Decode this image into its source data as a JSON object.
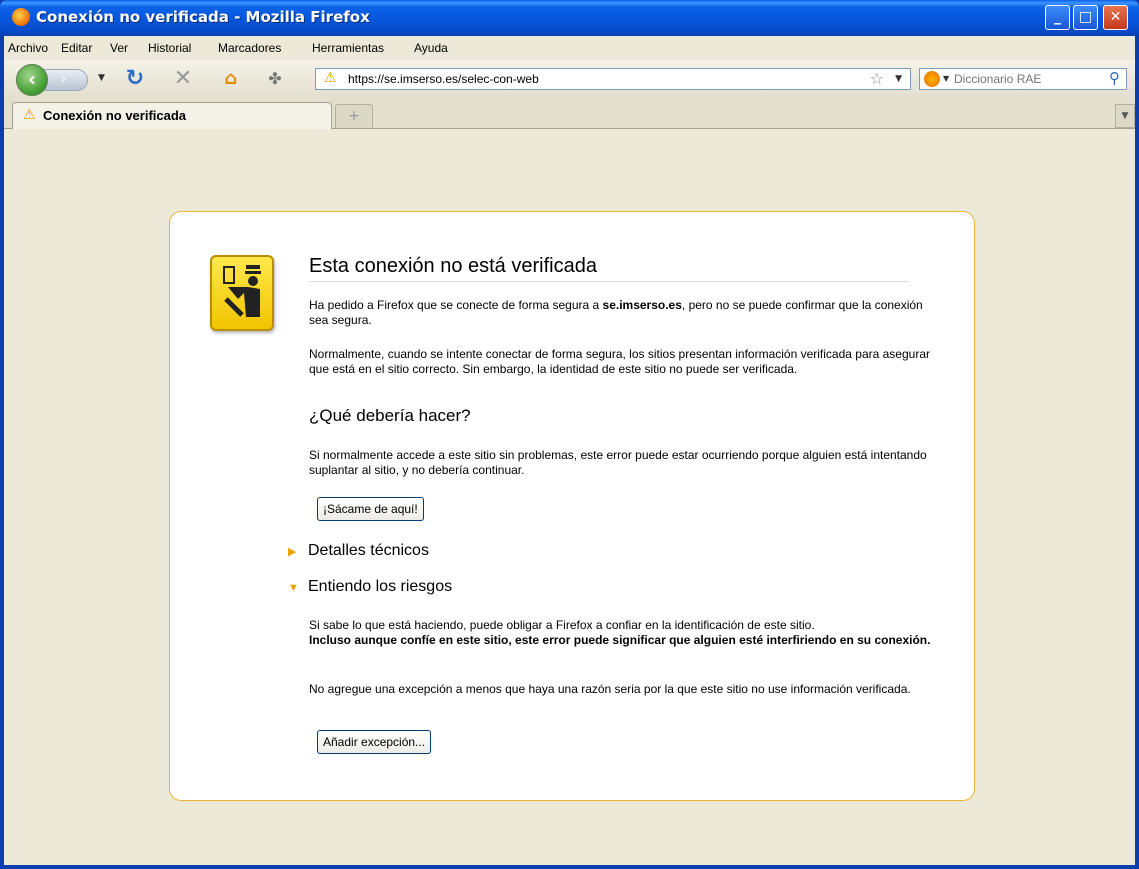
{
  "window": {
    "title": "Conexión no verificada - Mozilla Firefox",
    "buttons": {
      "minimize": "_",
      "maximize": "□",
      "close": "✕"
    }
  },
  "menu": [
    "Archivo",
    "Editar",
    "Ver",
    "Historial",
    "Marcadores",
    "Herramientas",
    "Ayuda"
  ],
  "navbar": {
    "url": "https://se.imserso.es/selec-con-web",
    "search_placeholder": "Diccionario RAE",
    "icons": [
      "back-icon",
      "forward-icon",
      "reload-icon",
      "stop-icon",
      "home-icon",
      "extension-icon",
      "warning-icon",
      "star-icon",
      "search-engine-icon",
      "magnifier-icon"
    ]
  },
  "tabs": {
    "active_label": "Conexión no verificada",
    "new_tab_symbol": "+"
  },
  "error": {
    "title": "Esta conexión no está verificada",
    "intro_prefix": "Ha pedido a Firefox que se conecte de forma segura a ",
    "intro_host": "se.imserso.es",
    "intro_suffix": ", pero no se puede confirmar que la conexión sea segura.",
    "explanation": "Normalmente, cuando se intente conectar de forma segura, los sitios presentan información verificada para asegurar que está en el sitio correcto. Sin embargo, la identidad de este sitio no puede ser verificada.",
    "what_heading": "¿Qué debería hacer?",
    "what_text": "Si normalmente accede a este sitio sin problemas, este error puede estar ocurriendo porque alguien está intentando suplantar al sitio, y no debería continuar.",
    "get_me_out": "¡Sácame de aquí!",
    "technical_details": "Detalles técnicos",
    "understand_risks": "Entiendo los riesgos",
    "risks_text": "Si sabe lo que está haciendo, puede obligar a Firefox a confiar en la identificación de este sitio.",
    "risks_bold": "Incluso aunque confíe en este sitio, este error puede significar que alguien esté interfiriendo en su conexión.",
    "no_exception_text": "No agregue una excepción a menos que haya una razón seria por la que este sitio no use información verificada.",
    "add_exception": "Añadir excepción..."
  },
  "colors": {
    "title_bar": "#0654D9",
    "box_border": "#E8B43A",
    "icon_yellow": "#FFE94B",
    "warning": "#E0A000"
  }
}
